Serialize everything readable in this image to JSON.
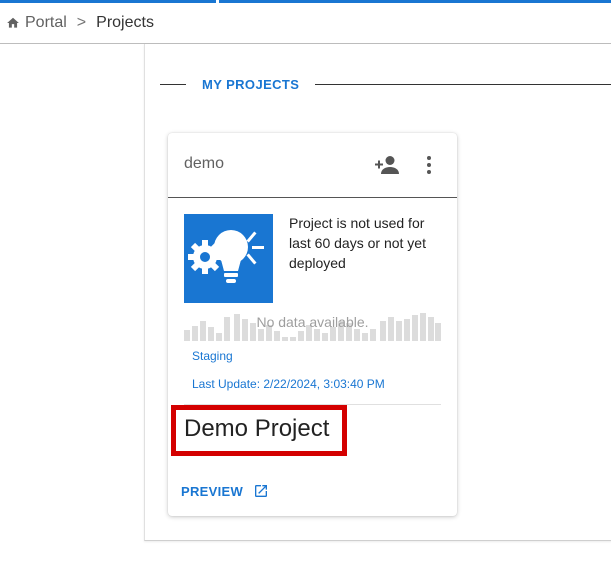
{
  "breadcrumb": {
    "home_label": "Portal",
    "separator": ">",
    "current": "Projects"
  },
  "section": {
    "title": "MY PROJECTS"
  },
  "card": {
    "name": "demo",
    "status_message": "Project is not used for last 60 days or not yet deployed",
    "chart_placeholder": "No data available.",
    "environment": "Staging",
    "last_update": "Last Update: 2/22/2024, 3:03:40 PM",
    "project_title": "Demo Project",
    "preview_label": "PREVIEW"
  },
  "colors": {
    "accent": "#1976d2",
    "highlight": "#d40000",
    "spark_bar": "#dcdcdc"
  },
  "icons": {
    "home": "home-icon",
    "add_user": "person-add-icon",
    "more": "more-vert-icon",
    "status": "lightbulb-gear-icon",
    "external": "open-in-new-icon"
  }
}
